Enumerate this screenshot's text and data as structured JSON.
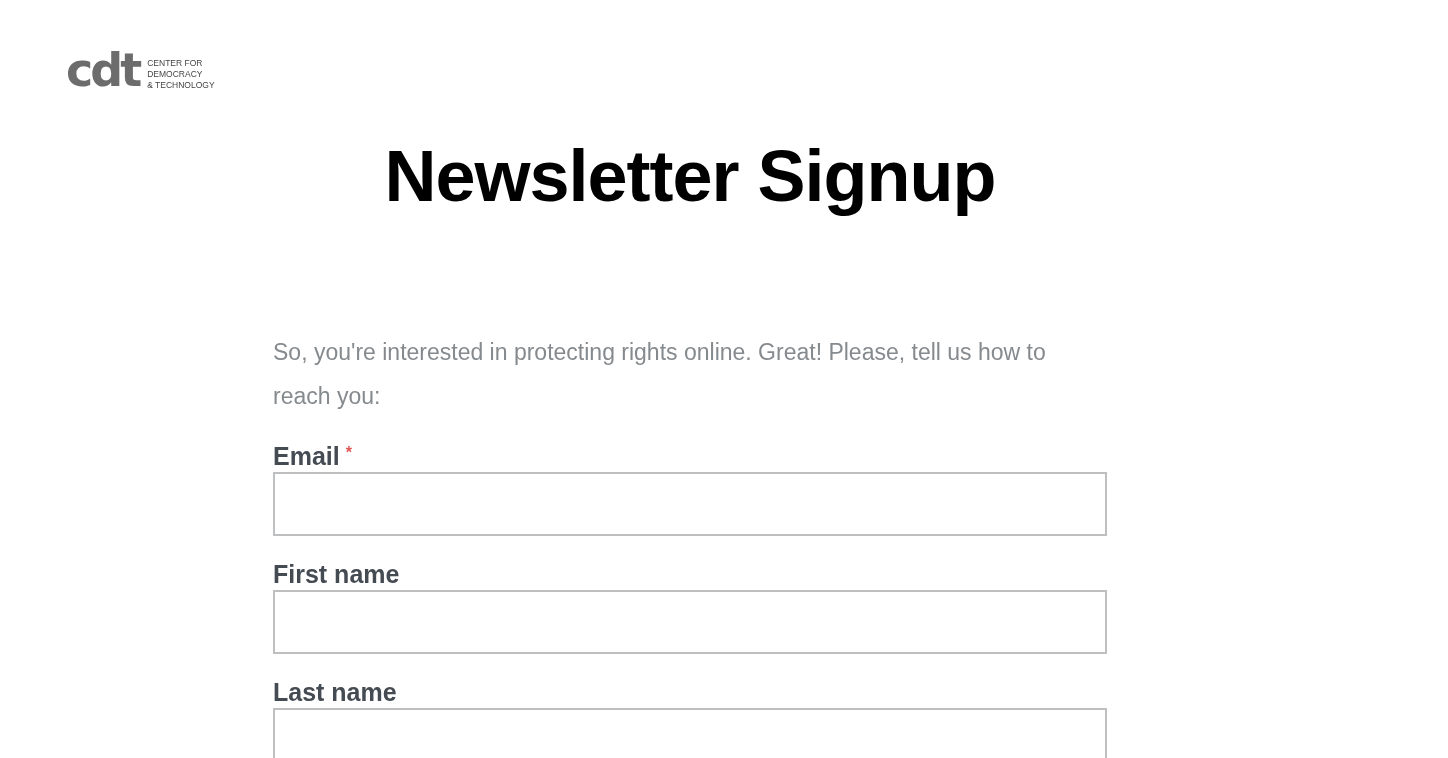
{
  "logo": {
    "mark": "cdt",
    "lines": [
      "CENTER FOR",
      "DEMOCRACY",
      "& TECHNOLOGY"
    ]
  },
  "title": "Newsletter Signup",
  "intro": "So, you're interested in protecting rights online. Great! Please, tell us how to reach you:",
  "fields": [
    {
      "label": "Email",
      "required_mark": "*"
    },
    {
      "label": "First name"
    },
    {
      "label": "Last name"
    }
  ]
}
